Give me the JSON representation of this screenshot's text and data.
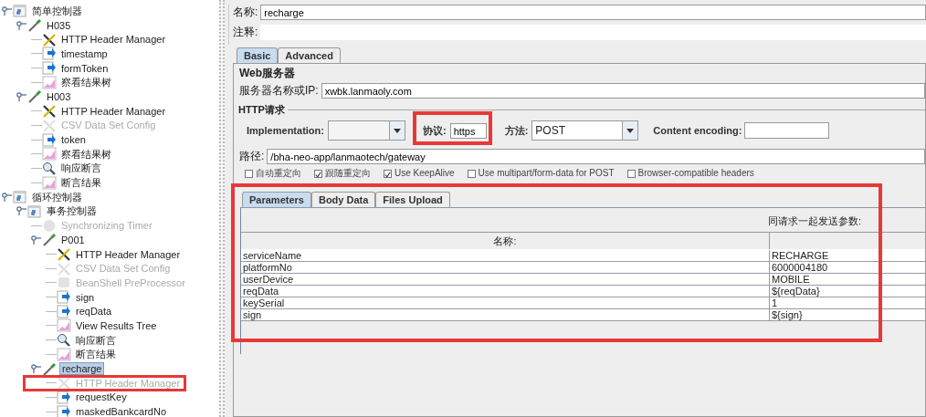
{
  "tree": [
    {
      "label": "简单控制器",
      "kind": "controller",
      "expanded": true,
      "disabled": false,
      "selected": false,
      "children": [
        {
          "label": "H035",
          "kind": "sampler",
          "expanded": true,
          "disabled": false,
          "selected": false,
          "children": [
            {
              "label": "HTTP Header Manager",
              "kind": "header",
              "disabled": false,
              "selected": false
            },
            {
              "label": "timestamp",
              "kind": "preprocessor",
              "disabled": false,
              "selected": false
            },
            {
              "label": "formToken",
              "kind": "preprocessor",
              "disabled": false,
              "selected": false
            },
            {
              "label": "察看结果树",
              "kind": "listener",
              "disabled": false,
              "selected": false
            }
          ]
        },
        {
          "label": "H003",
          "kind": "sampler",
          "expanded": true,
          "disabled": false,
          "selected": false,
          "children": [
            {
              "label": "HTTP Header Manager",
              "kind": "header",
              "disabled": false,
              "selected": false
            },
            {
              "label": "CSV Data Set Config",
              "kind": "header",
              "disabled": true,
              "selected": false
            },
            {
              "label": "token",
              "kind": "preprocessor",
              "disabled": false,
              "selected": false
            },
            {
              "label": "察看结果树",
              "kind": "listener",
              "disabled": false,
              "selected": false
            },
            {
              "label": "响应断言",
              "kind": "assertion",
              "disabled": false,
              "selected": false
            },
            {
              "label": "断言结果",
              "kind": "listener",
              "disabled": false,
              "selected": false
            }
          ]
        }
      ]
    },
    {
      "label": "循环控制器",
      "kind": "controller",
      "expanded": true,
      "disabled": false,
      "selected": false,
      "children": [
        {
          "label": "事务控制器",
          "kind": "controller",
          "expanded": true,
          "disabled": false,
          "selected": false,
          "children": [
            {
              "label": "Synchronizing Timer",
              "kind": "timer",
              "disabled": true,
              "selected": false
            },
            {
              "label": "P001",
              "kind": "sampler",
              "expanded": true,
              "disabled": false,
              "selected": false,
              "children": [
                {
                  "label": "HTTP Header Manager",
                  "kind": "header",
                  "disabled": false,
                  "selected": false
                },
                {
                  "label": "CSV Data Set Config",
                  "kind": "header",
                  "disabled": true,
                  "selected": false
                },
                {
                  "label": "BeanShell PreProcessor",
                  "kind": "block",
                  "disabled": true,
                  "selected": false
                },
                {
                  "label": "sign",
                  "kind": "preprocessor",
                  "disabled": false,
                  "selected": false
                },
                {
                  "label": "reqData",
                  "kind": "preprocessor",
                  "disabled": false,
                  "selected": false
                },
                {
                  "label": "View Results Tree",
                  "kind": "listener",
                  "disabled": false,
                  "selected": false
                },
                {
                  "label": "响应断言",
                  "kind": "assertion",
                  "disabled": false,
                  "selected": false
                },
                {
                  "label": "断言结果",
                  "kind": "listener",
                  "disabled": false,
                  "selected": false
                }
              ]
            },
            {
              "label": "recharge",
              "kind": "sampler",
              "expanded": true,
              "disabled": false,
              "selected": true,
              "children": [
                {
                  "label": "HTTP Header Manager",
                  "kind": "header",
                  "disabled": true,
                  "selected": false
                },
                {
                  "label": "requestKey",
                  "kind": "preprocessor",
                  "disabled": false,
                  "selected": false
                },
                {
                  "label": "maskedBankcardNo",
                  "kind": "preprocessor",
                  "disabled": false,
                  "selected": false
                }
              ]
            }
          ]
        }
      ]
    }
  ],
  "name": {
    "label": "名称:",
    "value": "recharge"
  },
  "comment": {
    "label": "注释:"
  },
  "tabs": [
    {
      "label": "Basic",
      "selected": true
    },
    {
      "label": "Advanced",
      "selected": false
    }
  ],
  "web_server": {
    "title": "Web服务器",
    "label": "服务器名称或IP:",
    "value": "xwbk.lanmaoly.com"
  },
  "http_request": {
    "title": "HTTP请求",
    "implementation_label": "Implementation:",
    "protocol_label": "协议:",
    "protocol": "https",
    "method_label": "方法:",
    "method": "POST",
    "encoding_label": "Content encoding:",
    "path_label": "路径:",
    "path": "/bha-neo-app/lanmaotech/gateway"
  },
  "options": [
    {
      "label": "自动重定向",
      "checked": false
    },
    {
      "label": "跟随重定向",
      "checked": true
    },
    {
      "label": "Use KeepAlive",
      "checked": true
    },
    {
      "label": "Use multipart/form-data for POST",
      "checked": false
    },
    {
      "label": "Browser-compatible headers",
      "checked": false
    }
  ],
  "body_tabs": [
    {
      "label": "Parameters",
      "selected": true
    },
    {
      "label": "Body Data",
      "selected": false
    },
    {
      "label": "Files Upload",
      "selected": false
    }
  ],
  "params": {
    "caption": "同请求一起发送参数:",
    "columns": [
      "名称:"
    ],
    "rows": [
      [
        "serviceName",
        "RECHARGE"
      ],
      [
        "platformNo",
        "6000004180"
      ],
      [
        "userDevice",
        "MOBILE"
      ],
      [
        "reqData",
        "${reqData}"
      ],
      [
        "keySerial",
        "1"
      ],
      [
        "sign",
        "${sign}"
      ]
    ]
  }
}
